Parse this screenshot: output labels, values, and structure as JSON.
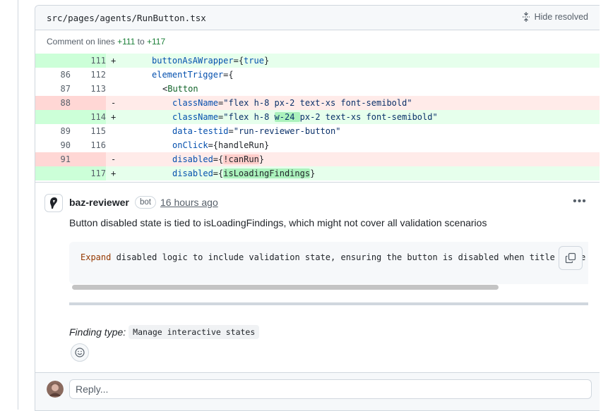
{
  "file": {
    "path": "src/pages/agents/RunButton.tsx",
    "hide_resolved_label": "Hide resolved",
    "comment_lines_prefix": "Comment on lines",
    "comment_lines_from": "+111",
    "comment_lines_to_word": "to",
    "comment_lines_to": "+117"
  },
  "diff": {
    "rows": [
      {
        "type": "add",
        "old": "",
        "new": "111",
        "sign": "+",
        "code": "buttonAsAWrapper={true}"
      },
      {
        "type": "ctx",
        "old": "86",
        "new": "112",
        "sign": "",
        "code": "elementTrigger={"
      },
      {
        "type": "ctx",
        "old": "87",
        "new": "113",
        "sign": "",
        "code": "<Button"
      },
      {
        "type": "del",
        "old": "88",
        "new": "",
        "sign": "-",
        "code": "className=\"flex h-8 px-2 text-xs font-semibold\""
      },
      {
        "type": "add",
        "old": "",
        "new": "114",
        "sign": "+",
        "code": "className=\"flex h-8 w-24 px-2 text-xs font-semibold\""
      },
      {
        "type": "ctx",
        "old": "89",
        "new": "115",
        "sign": "",
        "code": "data-testid=\"run-reviewer-button\""
      },
      {
        "type": "ctx",
        "old": "90",
        "new": "116",
        "sign": "",
        "code": "onClick={handleRun}"
      },
      {
        "type": "del",
        "old": "91",
        "new": "",
        "sign": "-",
        "code": "disabled={!canRun}"
      },
      {
        "type": "add",
        "old": "",
        "new": "117",
        "sign": "+",
        "code": "disabled={isLoadingFindings}"
      }
    ]
  },
  "comment": {
    "author": "baz-reviewer",
    "badge": "bot",
    "timestamp": "16 hours ago",
    "body": "Button disabled state is tied to isLoadingFindings, which might not cover all validation scenarios",
    "suggestion_keyword": "Expand",
    "suggestion_rest": " disabled logic to include validation state, ensuring the button is disabled when title or se",
    "finding_label": "Finding type:",
    "finding_value": "Manage interactive states"
  },
  "reply": {
    "placeholder": "Reply..."
  },
  "colors": {
    "add_bg": "#e6ffec",
    "add_gutter": "#ccffd8",
    "del_bg": "#ffebe9",
    "del_gutter": "#ffd7d5",
    "add_text": "#1a7f37"
  }
}
